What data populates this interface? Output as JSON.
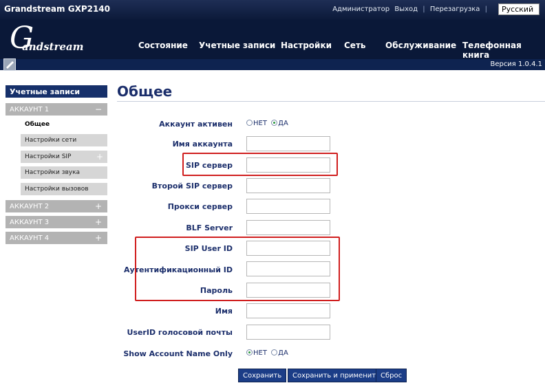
{
  "header": {
    "model": "Grandstream GXP2140",
    "links": [
      "Администратор",
      "Выход",
      "Перезагрузка"
    ],
    "language": "Русский",
    "logo_text": "andstream",
    "logo_letter": "G"
  },
  "nav": {
    "items": [
      "Состояние",
      "Учетные записи",
      "Настройки",
      "Сеть",
      "Обслуживание",
      "Телефонная книга"
    ]
  },
  "version": "Версия 1.0.4.1",
  "sidebar": {
    "header": "Учетные записи",
    "account1": "АККАУНТ 1",
    "collapse": "−",
    "expand": "+",
    "subitems": [
      "Общее",
      "Настройки сети",
      "Настройки SIP",
      "Настройки звука",
      "Настройки вызовов"
    ],
    "account2": "АККАУНТ 2",
    "account3": "АККАУНТ 3",
    "account4": "АККАУНТ 4"
  },
  "page_title": "Общее",
  "form": {
    "account_active": "Аккаунт активен",
    "no": "НЕТ",
    "yes": "ДА",
    "account_name": "Имя аккаунта",
    "sip_server": "SIP сервер",
    "second_sip_server": "Второй SIP сервер",
    "proxy_server": "Прокси сервер",
    "blf_server": "BLF Server",
    "sip_user_id": "SIP User ID",
    "auth_id": "Аутентификационный ID",
    "password": "Пароль",
    "name": "Имя",
    "voicemail_userid": "UserID голосовой почты",
    "show_account_name_only": "Show Account Name Only"
  },
  "buttons": {
    "save": "Сохранить",
    "save_apply": "Сохранить и применить",
    "reset": "Сброс"
  }
}
